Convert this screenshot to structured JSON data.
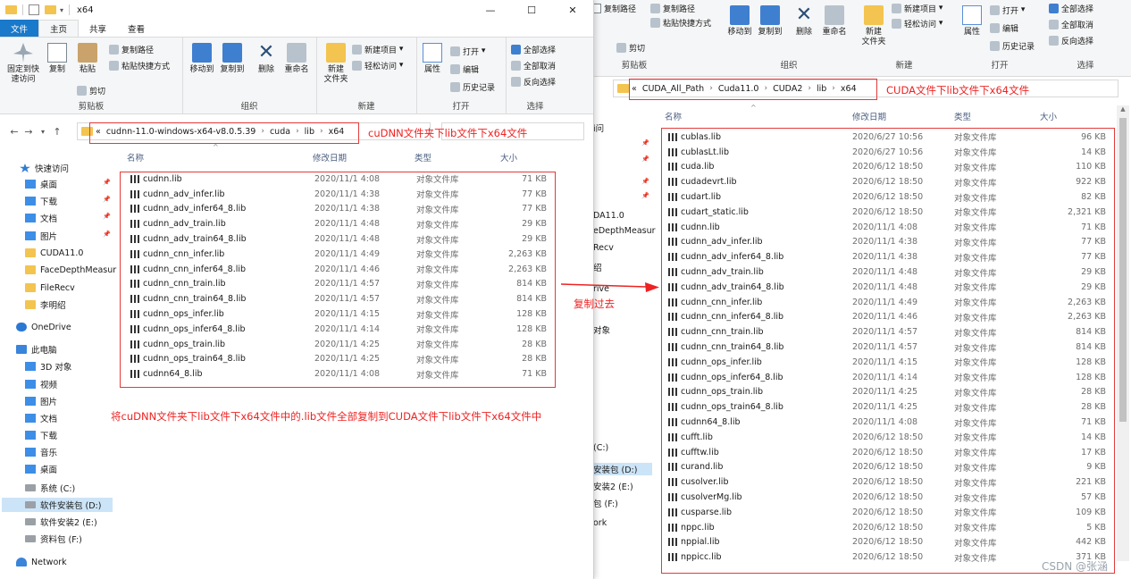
{
  "left": {
    "window_title": "x64",
    "ribbon_tabs": [
      "文件",
      "主页",
      "共享",
      "查看"
    ],
    "ribbon": {
      "pin_label": "固定到快\n速访问",
      "copy_label": "复制",
      "paste_label": "粘贴",
      "copy_path": "复制路径",
      "paste_shortcut": "粘贴快捷方式",
      "cut": "剪切",
      "clipboard_group": "剪贴板",
      "move_to": "移动到",
      "copy_to": "复制到",
      "delete": "删除",
      "rename": "重命名",
      "organize_group": "组织",
      "new_folder": "新建\n文件夹",
      "new_item": "新建项目",
      "easy_access": "轻松访问",
      "new_group": "新建",
      "properties": "属性",
      "open": "打开",
      "edit": "编辑",
      "history": "历史记录",
      "open_group": "打开",
      "select_all": "全部选择",
      "select_none": "全部取消",
      "invert": "反向选择",
      "select_group": "选择"
    },
    "breadcrumb": [
      "«",
      "cudnn-11.0-windows-x64-v8.0.5.39",
      "cuda",
      "lib",
      "x64"
    ],
    "nav": [
      {
        "label": "快速访问",
        "icon": "star-icon",
        "pin": false
      },
      {
        "label": "桌面",
        "icon": "desktop-icon",
        "pin": true
      },
      {
        "label": "下载",
        "icon": "download-icon",
        "pin": true
      },
      {
        "label": "文档",
        "icon": "document-icon",
        "pin": true
      },
      {
        "label": "图片",
        "icon": "picture-icon",
        "pin": true
      },
      {
        "label": "CUDA11.0",
        "icon": "folder-icon",
        "pin": false
      },
      {
        "label": "FaceDepthMeasur",
        "icon": "folder-icon",
        "pin": false
      },
      {
        "label": "FileRecv",
        "icon": "folder-icon",
        "pin": false
      },
      {
        "label": "李明绍",
        "icon": "folder-icon",
        "pin": false
      },
      {
        "label": "OneDrive",
        "icon": "cloud-icon",
        "pin": false
      },
      {
        "label": "此电脑",
        "icon": "pc-icon",
        "pin": false
      },
      {
        "label": "3D 对象",
        "icon": "3d-object-icon",
        "pin": false
      },
      {
        "label": "视频",
        "icon": "video-icon",
        "pin": false
      },
      {
        "label": "图片",
        "icon": "picture-icon",
        "pin": false
      },
      {
        "label": "文档",
        "icon": "document-icon",
        "pin": false
      },
      {
        "label": "下载",
        "icon": "download-icon",
        "pin": false
      },
      {
        "label": "音乐",
        "icon": "music-icon",
        "pin": false
      },
      {
        "label": "桌面",
        "icon": "desktop-icon",
        "pin": false
      },
      {
        "label": "系统 (C:)",
        "icon": "drive-icon",
        "pin": false
      },
      {
        "label": "软件安装包 (D:)",
        "icon": "drive-icon",
        "pin": false
      },
      {
        "label": "软件安装2 (E:)",
        "icon": "drive-icon",
        "pin": false
      },
      {
        "label": "资料包 (F:)",
        "icon": "drive-icon",
        "pin": false
      },
      {
        "label": "Network",
        "icon": "network-icon",
        "pin": false
      }
    ],
    "columns": [
      "名称",
      "修改日期",
      "类型",
      "大小"
    ],
    "files": [
      {
        "name": "cudnn.lib",
        "date": "2020/11/1 4:08",
        "type": "对象文件库",
        "size": "71 KB"
      },
      {
        "name": "cudnn_adv_infer.lib",
        "date": "2020/11/1 4:38",
        "type": "对象文件库",
        "size": "77 KB"
      },
      {
        "name": "cudnn_adv_infer64_8.lib",
        "date": "2020/11/1 4:38",
        "type": "对象文件库",
        "size": "77 KB"
      },
      {
        "name": "cudnn_adv_train.lib",
        "date": "2020/11/1 4:48",
        "type": "对象文件库",
        "size": "29 KB"
      },
      {
        "name": "cudnn_adv_train64_8.lib",
        "date": "2020/11/1 4:48",
        "type": "对象文件库",
        "size": "29 KB"
      },
      {
        "name": "cudnn_cnn_infer.lib",
        "date": "2020/11/1 4:49",
        "type": "对象文件库",
        "size": "2,263 KB"
      },
      {
        "name": "cudnn_cnn_infer64_8.lib",
        "date": "2020/11/1 4:46",
        "type": "对象文件库",
        "size": "2,263 KB"
      },
      {
        "name": "cudnn_cnn_train.lib",
        "date": "2020/11/1 4:57",
        "type": "对象文件库",
        "size": "814 KB"
      },
      {
        "name": "cudnn_cnn_train64_8.lib",
        "date": "2020/11/1 4:57",
        "type": "对象文件库",
        "size": "814 KB"
      },
      {
        "name": "cudnn_ops_infer.lib",
        "date": "2020/11/1 4:15",
        "type": "对象文件库",
        "size": "128 KB"
      },
      {
        "name": "cudnn_ops_infer64_8.lib",
        "date": "2020/11/1 4:14",
        "type": "对象文件库",
        "size": "128 KB"
      },
      {
        "name": "cudnn_ops_train.lib",
        "date": "2020/11/1 4:25",
        "type": "对象文件库",
        "size": "28 KB"
      },
      {
        "name": "cudnn_ops_train64_8.lib",
        "date": "2020/11/1 4:25",
        "type": "对象文件库",
        "size": "28 KB"
      },
      {
        "name": "cudnn64_8.lib",
        "date": "2020/11/1 4:08",
        "type": "对象文件库",
        "size": "71 KB"
      }
    ]
  },
  "right": {
    "ribbon": {
      "copy_path": "复制路径",
      "paste_shortcut": "粘贴快捷方式",
      "cut": "剪切",
      "clipboard_group": "剪贴板",
      "move_to": "移动到",
      "copy_to": "复制到",
      "delete": "删除",
      "rename": "重命名",
      "organize_group": "组织",
      "new_folder": "新建\n文件夹",
      "new_item": "新建项目",
      "easy_access": "轻松访问",
      "new_group": "新建",
      "properties": "属性",
      "open": "打开",
      "edit": "编辑",
      "history": "历史记录",
      "open_group": "打开",
      "select_all": "全部选择",
      "select_none": "全部取消",
      "invert": "反向选择",
      "select_group": "选择"
    },
    "breadcrumb": [
      "«",
      "CUDA_All_Path",
      "Cuda11.0",
      "CUDA2",
      "lib",
      "x64"
    ],
    "columns": [
      "名称",
      "修改日期",
      "类型",
      "大小"
    ],
    "behind_nav": [
      "i问",
      "DA11.0",
      "eDepthMeasur",
      "Recv",
      "绍",
      "rive",
      "对象",
      "(C:)",
      "安装包 (D:)",
      "安装2 (E:)",
      "包 (F:)",
      "ork"
    ],
    "files": [
      {
        "name": "cublas.lib",
        "date": "2020/6/27 10:56",
        "type": "对象文件库",
        "size": "96 KB"
      },
      {
        "name": "cublasLt.lib",
        "date": "2020/6/27 10:56",
        "type": "对象文件库",
        "size": "14 KB"
      },
      {
        "name": "cuda.lib",
        "date": "2020/6/12 18:50",
        "type": "对象文件库",
        "size": "110 KB"
      },
      {
        "name": "cudadevrt.lib",
        "date": "2020/6/12 18:50",
        "type": "对象文件库",
        "size": "922 KB"
      },
      {
        "name": "cudart.lib",
        "date": "2020/6/12 18:50",
        "type": "对象文件库",
        "size": "82 KB"
      },
      {
        "name": "cudart_static.lib",
        "date": "2020/6/12 18:50",
        "type": "对象文件库",
        "size": "2,321 KB"
      },
      {
        "name": "cudnn.lib",
        "date": "2020/11/1 4:08",
        "type": "对象文件库",
        "size": "71 KB"
      },
      {
        "name": "cudnn_adv_infer.lib",
        "date": "2020/11/1 4:38",
        "type": "对象文件库",
        "size": "77 KB"
      },
      {
        "name": "cudnn_adv_infer64_8.lib",
        "date": "2020/11/1 4:38",
        "type": "对象文件库",
        "size": "77 KB"
      },
      {
        "name": "cudnn_adv_train.lib",
        "date": "2020/11/1 4:48",
        "type": "对象文件库",
        "size": "29 KB"
      },
      {
        "name": "cudnn_adv_train64_8.lib",
        "date": "2020/11/1 4:48",
        "type": "对象文件库",
        "size": "29 KB"
      },
      {
        "name": "cudnn_cnn_infer.lib",
        "date": "2020/11/1 4:49",
        "type": "对象文件库",
        "size": "2,263 KB"
      },
      {
        "name": "cudnn_cnn_infer64_8.lib",
        "date": "2020/11/1 4:46",
        "type": "对象文件库",
        "size": "2,263 KB"
      },
      {
        "name": "cudnn_cnn_train.lib",
        "date": "2020/11/1 4:57",
        "type": "对象文件库",
        "size": "814 KB"
      },
      {
        "name": "cudnn_cnn_train64_8.lib",
        "date": "2020/11/1 4:57",
        "type": "对象文件库",
        "size": "814 KB"
      },
      {
        "name": "cudnn_ops_infer.lib",
        "date": "2020/11/1 4:15",
        "type": "对象文件库",
        "size": "128 KB"
      },
      {
        "name": "cudnn_ops_infer64_8.lib",
        "date": "2020/11/1 4:14",
        "type": "对象文件库",
        "size": "128 KB"
      },
      {
        "name": "cudnn_ops_train.lib",
        "date": "2020/11/1 4:25",
        "type": "对象文件库",
        "size": "28 KB"
      },
      {
        "name": "cudnn_ops_train64_8.lib",
        "date": "2020/11/1 4:25",
        "type": "对象文件库",
        "size": "28 KB"
      },
      {
        "name": "cudnn64_8.lib",
        "date": "2020/11/1 4:08",
        "type": "对象文件库",
        "size": "71 KB"
      },
      {
        "name": "cufft.lib",
        "date": "2020/6/12 18:50",
        "type": "对象文件库",
        "size": "14 KB"
      },
      {
        "name": "cufftw.lib",
        "date": "2020/6/12 18:50",
        "type": "对象文件库",
        "size": "17 KB"
      },
      {
        "name": "curand.lib",
        "date": "2020/6/12 18:50",
        "type": "对象文件库",
        "size": "9 KB"
      },
      {
        "name": "cusolver.lib",
        "date": "2020/6/12 18:50",
        "type": "对象文件库",
        "size": "221 KB"
      },
      {
        "name": "cusolverMg.lib",
        "date": "2020/6/12 18:50",
        "type": "对象文件库",
        "size": "57 KB"
      },
      {
        "name": "cusparse.lib",
        "date": "2020/6/12 18:50",
        "type": "对象文件库",
        "size": "109 KB"
      },
      {
        "name": "nppc.lib",
        "date": "2020/6/12 18:50",
        "type": "对象文件库",
        "size": "5 KB"
      },
      {
        "name": "nppial.lib",
        "date": "2020/6/12 18:50",
        "type": "对象文件库",
        "size": "442 KB"
      },
      {
        "name": "nppicc.lib",
        "date": "2020/6/12 18:50",
        "type": "对象文件库",
        "size": "371 KB"
      }
    ]
  },
  "annotations": {
    "left_path_note": "cuDNN文件夹下lib文件下x64文件",
    "right_path_note": "CUDA文件下lib文件下x64文件",
    "copy_note": "复制过去",
    "instruction": "将cuDNN文件夹下lib文件下x64文件中的.lib文件全部复制到CUDA文件下lib文件下x64文件中"
  },
  "watermark": "CSDN @张涵",
  "colors": {
    "accent": "#1979ca",
    "annotation_red": "#e22222",
    "header_text": "#4d6082"
  }
}
